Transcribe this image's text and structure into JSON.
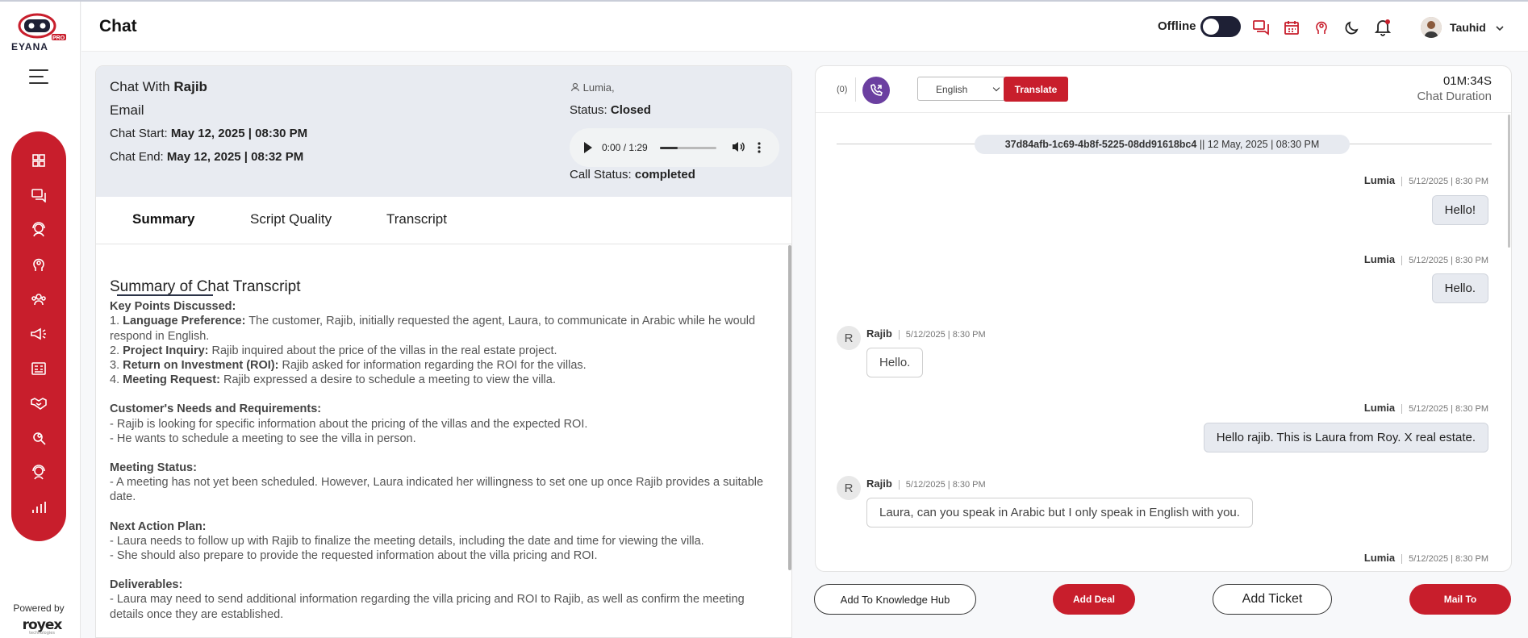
{
  "header": {
    "title": "Chat",
    "status_label": "Offline",
    "user_name": "Tauhid"
  },
  "sidebar": {
    "powered_by": "Powered by",
    "brand": "royex",
    "brand_sub": "technologies",
    "items": [
      "dashboard-icon",
      "chat-icon",
      "agent-icon",
      "ai-brain-icon",
      "team-icon",
      "campaign-icon",
      "report-card-icon",
      "handshake-icon",
      "search-user-icon",
      "support-agent-icon",
      "analytics-icon"
    ]
  },
  "chat_info": {
    "with_label": "Chat With",
    "with_name": "Rajib",
    "channel": "Email",
    "start_label": "Chat Start:",
    "start_value": "May 12, 2025 | 08:30 PM",
    "end_label": "Chat End:",
    "end_value": "May 12, 2025 | 08:32 PM",
    "agent": "Lumia,",
    "status_label": "Status:",
    "status_value": "Closed",
    "audio_time": "0:00 / 1:29",
    "audio_progress": 0.0,
    "call_status_label": "Call Status:",
    "call_status_value": "completed"
  },
  "tabs": [
    "Summary",
    "Script Quality",
    "Transcript"
  ],
  "summary": {
    "heading": "Summary of Chat Transcript",
    "key_points_title": "Key Points Discussed:",
    "points": [
      {
        "num": "1.",
        "label": "Language Preference:",
        "text": " The customer, Rajib, initially requested the agent, Laura, to communicate in Arabic while he would respond in English."
      },
      {
        "num": "2.",
        "label": "Project Inquiry:",
        "text": " Rajib inquired about the price of the villas in the real estate project."
      },
      {
        "num": "3.",
        "label": "Return on Investment (ROI):",
        "text": " Rajib asked for information regarding the ROI for the villas."
      },
      {
        "num": "4.",
        "label": "Meeting Request:",
        "text": " Rajib expressed a desire to schedule a meeting to view the villa."
      }
    ],
    "needs_title": "Customer's Needs and Requirements:",
    "needs": [
      "- Rajib is looking for specific information about the pricing of the villas and the expected ROI.",
      "- He wants to schedule a meeting to see the villa in person."
    ],
    "meeting_title": "Meeting Status:",
    "meeting": [
      "- A meeting has not yet been scheduled. However, Laura indicated her willingness to set one up once Rajib provides a suitable date."
    ],
    "next_title": "Next Action Plan:",
    "next": [
      "- Laura needs to follow up with Rajib to finalize the meeting details, including the date and time for viewing the villa.",
      "- She should also prepare to provide the requested information about the villa pricing and ROI."
    ],
    "deliverables_title": "Deliverables:",
    "deliverables": [
      "- Laura may need to send additional information regarding the villa pricing and ROI to Rajib, as well as confirm the meeting details once they are established."
    ]
  },
  "chat_panel": {
    "count": "(0)",
    "language": "English",
    "translate_label": "Translate",
    "duration_value": "01M:34S",
    "duration_label": "Chat Duration",
    "session_id": "37d84afb-1c69-4b8f-5225-08dd91618bc4",
    "session_date": " || 12 May, 2025 | 08:30 PM",
    "messages": [
      {
        "sender": "Lumia",
        "time": "5/12/2025 | 8:30 PM",
        "text": "Hello!",
        "dir": "out"
      },
      {
        "sender": "Lumia",
        "time": "5/12/2025 | 8:30 PM",
        "text": "Hello.",
        "dir": "out"
      },
      {
        "sender": "Rajib",
        "initial": "R",
        "time": "5/12/2025 | 8:30 PM",
        "text": "Hello.",
        "dir": "in"
      },
      {
        "sender": "Lumia",
        "time": "5/12/2025 | 8:30 PM",
        "text": "Hello rajib. This is Laura from Roy. X real estate.",
        "dir": "out"
      },
      {
        "sender": "Rajib",
        "initial": "R",
        "time": "5/12/2025 | 8:30 PM",
        "text": "Laura, can you speak in Arabic but I only speak in English with you.",
        "dir": "in"
      },
      {
        "sender": "Lumia",
        "time": "5/12/2025 | 8:30 PM",
        "text": "",
        "dir": "out"
      }
    ]
  },
  "actions": {
    "knowledge": "Add To Knowledge Hub",
    "deal": "Add Deal",
    "ticket": "Add Ticket",
    "mail": "Mail To"
  },
  "colors": {
    "brand_red": "#c81e2c",
    "nav_dark": "#1e2035",
    "phone_purple": "#6b3fa0"
  }
}
